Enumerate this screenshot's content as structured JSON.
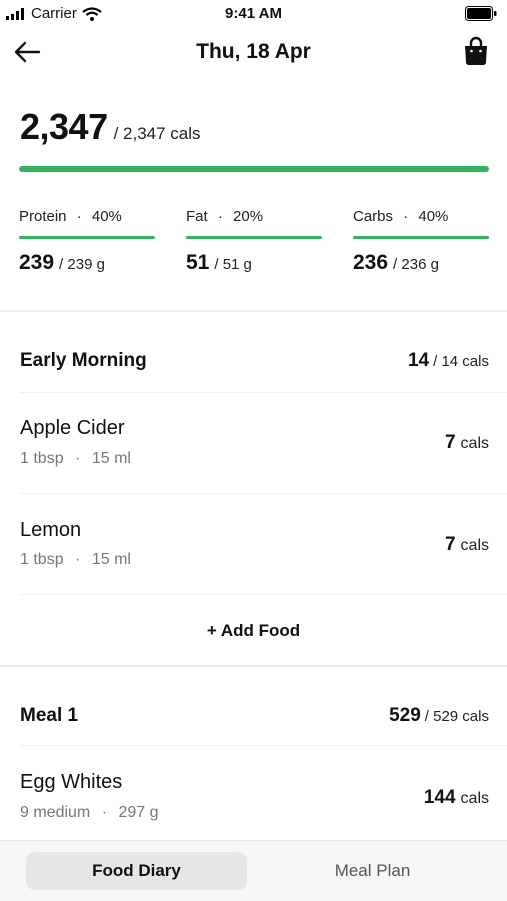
{
  "status_bar": {
    "carrier": "Carrier",
    "time": "9:41 AM"
  },
  "header": {
    "date": "Thu, 18 Apr"
  },
  "summary": {
    "consumed": "2,347",
    "target": "/ 2,347 cals",
    "progress": 1.0
  },
  "macros": [
    {
      "name": "Protein",
      "percent": "40%",
      "value": "239",
      "target": "/ 239 g"
    },
    {
      "name": "Fat",
      "percent": "20%",
      "value": "51",
      "target": "/ 51 g"
    },
    {
      "name": "Carbs",
      "percent": "40%",
      "value": "236",
      "target": "/ 236 g"
    }
  ],
  "sections": [
    {
      "title": "Early Morning",
      "cal_value": "14",
      "cal_target": "/ 14 cals",
      "foods": [
        {
          "name": "Apple Cider",
          "amount": "1 tbsp",
          "weight": "15 ml",
          "cal": "7",
          "unit": "cals"
        },
        {
          "name": "Lemon",
          "amount": "1 tbsp",
          "weight": "15 ml",
          "cal": "7",
          "unit": "cals"
        }
      ],
      "add_label": "+ Add Food"
    },
    {
      "title": "Meal 1",
      "cal_value": "529",
      "cal_target": "/ 529 cals",
      "foods": [
        {
          "name": "Egg Whites",
          "amount": "9 medium",
          "weight": "297 g",
          "cal": "144",
          "unit": "cals"
        }
      ]
    }
  ],
  "tabs": {
    "food_diary": "Food Diary",
    "meal_plan": "Meal Plan"
  },
  "separator": "·",
  "colors": {
    "accent": "#33b35e"
  }
}
